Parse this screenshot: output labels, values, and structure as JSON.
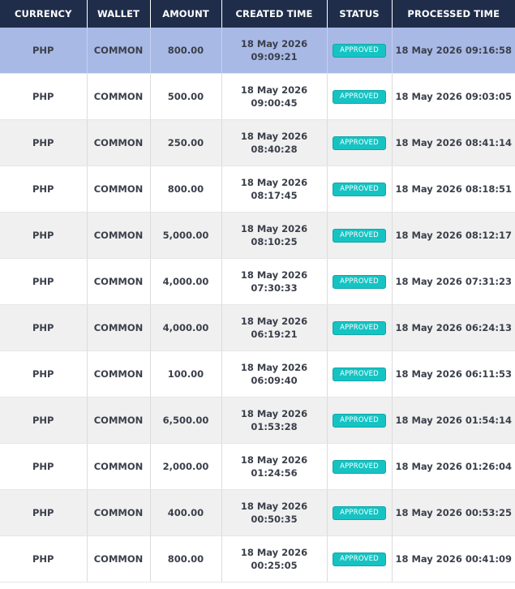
{
  "table": {
    "headers": {
      "currency": "CURRENCY",
      "wallet": "WALLET",
      "amount": "AMOUNT",
      "created": "CREATED TIME",
      "status": "STATUS",
      "processed": "PROCESSED TIME"
    },
    "rows": [
      {
        "currency": "PHP",
        "wallet": "COMMON",
        "amount": "800.00",
        "created_date": "18 May 2026",
        "created_time": "09:09:21",
        "status": "APPROVED",
        "processed": "18 May 2026 09:16:58"
      },
      {
        "currency": "PHP",
        "wallet": "COMMON",
        "amount": "500.00",
        "created_date": "18 May 2026",
        "created_time": "09:00:45",
        "status": "APPROVED",
        "processed": "18 May 2026 09:03:05"
      },
      {
        "currency": "PHP",
        "wallet": "COMMON",
        "amount": "250.00",
        "created_date": "18 May 2026",
        "created_time": "08:40:28",
        "status": "APPROVED",
        "processed": "18 May 2026 08:41:14"
      },
      {
        "currency": "PHP",
        "wallet": "COMMON",
        "amount": "800.00",
        "created_date": "18 May 2026",
        "created_time": "08:17:45",
        "status": "APPROVED",
        "processed": "18 May 2026 08:18:51"
      },
      {
        "currency": "PHP",
        "wallet": "COMMON",
        "amount": "5,000.00",
        "created_date": "18 May 2026",
        "created_time": "08:10:25",
        "status": "APPROVED",
        "processed": "18 May 2026 08:12:17"
      },
      {
        "currency": "PHP",
        "wallet": "COMMON",
        "amount": "4,000.00",
        "created_date": "18 May 2026",
        "created_time": "07:30:33",
        "status": "APPROVED",
        "processed": "18 May 2026 07:31:23"
      },
      {
        "currency": "PHP",
        "wallet": "COMMON",
        "amount": "4,000.00",
        "created_date": "18 May 2026",
        "created_time": "06:19:21",
        "status": "APPROVED",
        "processed": "18 May 2026 06:24:13"
      },
      {
        "currency": "PHP",
        "wallet": "COMMON",
        "amount": "100.00",
        "created_date": "18 May 2026",
        "created_time": "06:09:40",
        "status": "APPROVED",
        "processed": "18 May 2026 06:11:53"
      },
      {
        "currency": "PHP",
        "wallet": "COMMON",
        "amount": "6,500.00",
        "created_date": "18 May 2026",
        "created_time": "01:53:28",
        "status": "APPROVED",
        "processed": "18 May 2026 01:54:14"
      },
      {
        "currency": "PHP",
        "wallet": "COMMON",
        "amount": "2,000.00",
        "created_date": "18 May 2026",
        "created_time": "01:24:56",
        "status": "APPROVED",
        "processed": "18 May 2026 01:26:04"
      },
      {
        "currency": "PHP",
        "wallet": "COMMON",
        "amount": "400.00",
        "created_date": "18 May 2026",
        "created_time": "00:50:35",
        "status": "APPROVED",
        "processed": "18 May 2026 00:53:25"
      },
      {
        "currency": "PHP",
        "wallet": "COMMON",
        "amount": "800.00",
        "created_date": "18 May 2026",
        "created_time": "00:25:05",
        "status": "APPROVED",
        "processed": "18 May 2026 00:41:09"
      }
    ]
  },
  "colors": {
    "header_bg": "#1f2d4a",
    "selected_row_bg": "#a9b9e6",
    "alt_row_bg": "#f0f0f0",
    "status_approved": "#16c3c3"
  }
}
